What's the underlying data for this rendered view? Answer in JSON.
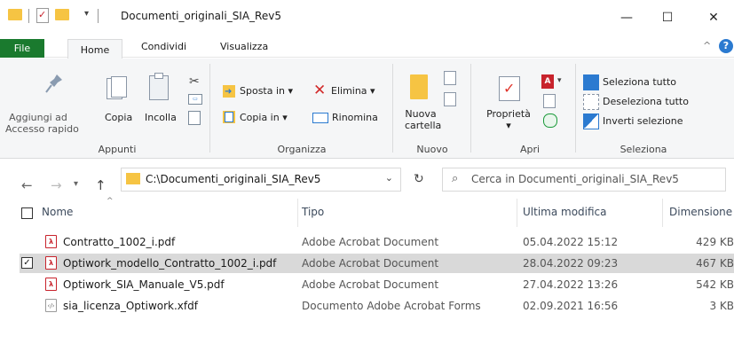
{
  "window": {
    "title": "Documenti_originali_SIA_Rev5",
    "minimize": "—",
    "maximize": "☐",
    "close": "✕"
  },
  "ribbon_tabs": {
    "file": "File",
    "home": "Home",
    "share": "Condividi",
    "view": "Visualizza"
  },
  "clipboard": {
    "pin": "Aggiungi ad\nAccesso rapido",
    "pin_line1": "Aggiungi ad",
    "pin_line2": "Accesso rapido",
    "copy": "Copia",
    "paste": "Incolla",
    "group": "Appunti"
  },
  "organize": {
    "move_to": "Sposta in",
    "copy_to": "Copia in",
    "delete": "Elimina",
    "rename": "Rinomina",
    "group": "Organizza"
  },
  "new": {
    "new_folder_line1": "Nuova",
    "new_folder_line2": "cartella",
    "group": "Nuovo"
  },
  "open": {
    "properties": "Proprietà",
    "group": "Apri"
  },
  "select": {
    "select_all": "Seleziona tutto",
    "deselect_all": "Deseleziona tutto",
    "invert": "Inverti selezione",
    "group": "Seleziona"
  },
  "address": {
    "path": "C:\\Documenti_originali_SIA_Rev5",
    "search_placeholder": "Cerca in Documenti_originali_SIA_Rev5"
  },
  "columns": {
    "name": "Nome",
    "type": "Tipo",
    "modified": "Ultima modifica",
    "size": "Dimensione"
  },
  "files": [
    {
      "name": "Contratto_1002_i.pdf",
      "type": "Adobe Acrobat Document",
      "modified": "05.04.2022 15:12",
      "size": "429 KB",
      "icon": "pdf-icon",
      "selected": false
    },
    {
      "name": "Optiwork_modello_Contratto_1002_i.pdf",
      "type": "Adobe Acrobat Document",
      "modified": "28.04.2022 09:23",
      "size": "467 KB",
      "icon": "pdf-icon",
      "selected": true
    },
    {
      "name": "Optiwork_SIA_Manuale_V5.pdf",
      "type": "Adobe Acrobat Document",
      "modified": "27.04.2022 13:26",
      "size": "542 KB",
      "icon": "pdf-icon",
      "selected": false
    },
    {
      "name": "sia_licenza_Optiwork.xfdf",
      "type": "Documento Adobe Acrobat Forms",
      "modified": "02.09.2021 16:56",
      "size": "3 KB",
      "icon": "xfdf-icon",
      "selected": false
    }
  ],
  "colors": {
    "file_tab": "#1a7a2e",
    "folder": "#f6c443",
    "pdf": "#c8232c",
    "selection": "#d9d9d9",
    "accent_blue": "#2b7ad0"
  }
}
